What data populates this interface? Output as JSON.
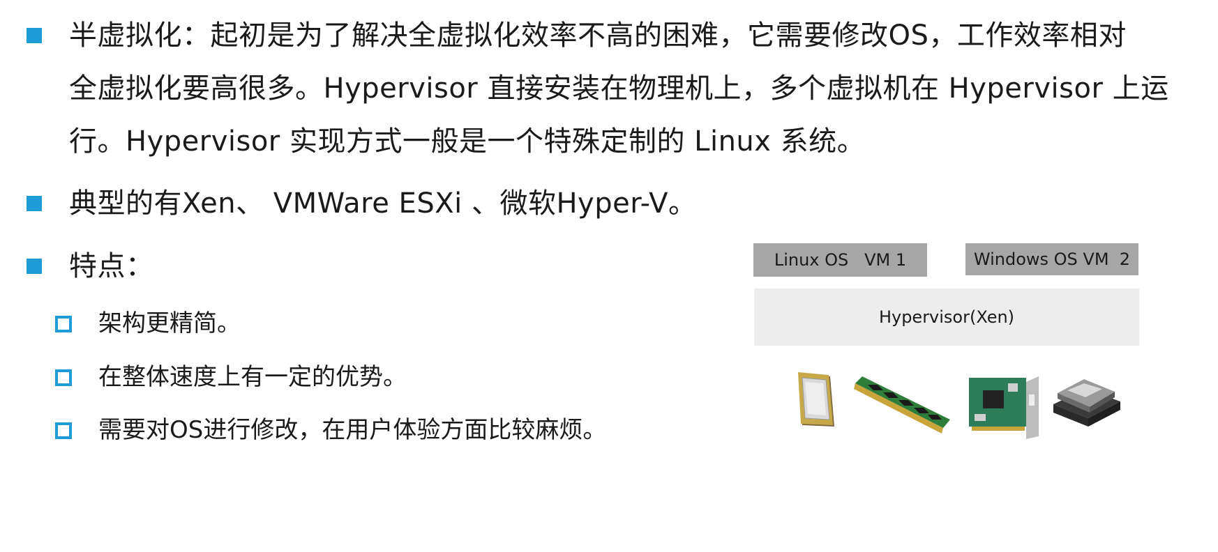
{
  "bullets": [
    {
      "lines": [
        "半虚拟化：起初是为了解决全虚拟化效率不高的困难，它需要修改OS，工作效率相对",
        "全虚拟化要高很多。Hypervisor 直接安装在物理机上，多个虚拟机在 Hypervisor 上运",
        "行。Hypervisor 实现方式一般是一个特殊定制的 Linux 系统。"
      ]
    },
    {
      "text": "典型的有Xen、 VMWare  ESXi 、微软Hyper-V。"
    },
    {
      "text": "特点："
    }
  ],
  "sub_bullets": [
    "架构更精简。",
    "在整体速度上有一定的优势。",
    "需要对OS进行修改，在用户体验方面比较麻烦。"
  ],
  "diagram": {
    "vm1_label": "Linux OS   VM 1",
    "vm2_label": "Windows OS VM  2",
    "hypervisor_label": "Hypervisor(Xen)",
    "hardware": [
      "cpu-chip",
      "ram-module",
      "network-card",
      "hard-disk"
    ]
  },
  "colors": {
    "bullet": "#1e9cd7",
    "vm_box": "#a6a6a6",
    "hypervisor_box": "#ededed"
  }
}
